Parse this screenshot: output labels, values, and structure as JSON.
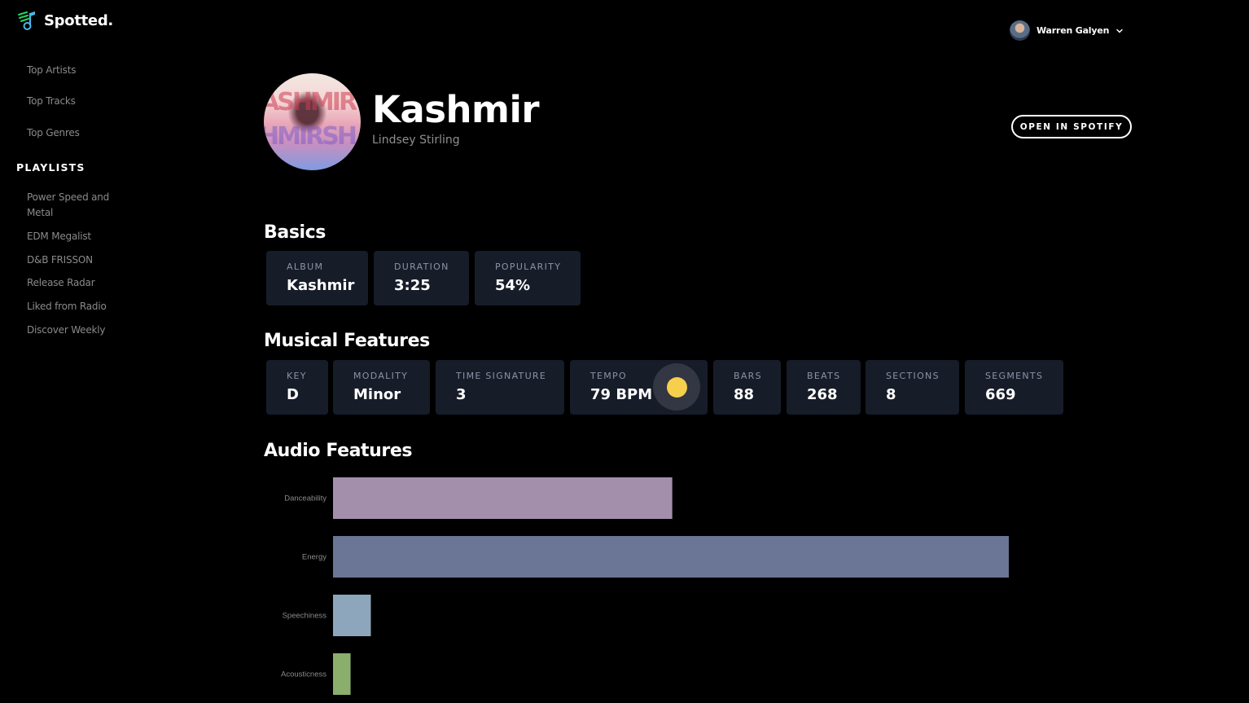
{
  "app": {
    "name": "Spotted."
  },
  "sidebar": {
    "nav": [
      "Top Artists",
      "Top Tracks",
      "Top Genres"
    ],
    "playlists_heading": "PLAYLISTS",
    "playlists": [
      "Power Speed and Metal",
      "EDM Megalist",
      "D&B FRISSON",
      "Release Radar",
      "Liked from Radio",
      "Discover Weekly"
    ]
  },
  "user": {
    "name": "Warren Galyen"
  },
  "track": {
    "title": "Kashmir",
    "artist": "Lindsey Stirling",
    "open_button": "OPEN IN SPOTIFY"
  },
  "basics": {
    "title": "Basics",
    "cards": [
      {
        "label": "ALBUM",
        "value": "Kashmir"
      },
      {
        "label": "DURATION",
        "value": "3:25"
      },
      {
        "label": "POPULARITY",
        "value": "54%"
      }
    ]
  },
  "musical": {
    "title": "Musical Features",
    "cards": [
      {
        "label": "KEY",
        "value": "D"
      },
      {
        "label": "MODALITY",
        "value": "Minor"
      },
      {
        "label": "TIME SIGNATURE",
        "value": "3"
      },
      {
        "label": "TEMPO",
        "value": "79 BPM"
      },
      {
        "label": "BARS",
        "value": "88"
      },
      {
        "label": "BEATS",
        "value": "268"
      },
      {
        "label": "SECTIONS",
        "value": "8"
      },
      {
        "label": "SEGMENTS",
        "value": "669"
      }
    ]
  },
  "audio": {
    "title": "Audio Features"
  },
  "colors": {
    "card_bg": "#171c29",
    "tempo_indicator": "#f6cf4c"
  },
  "chart_data": {
    "type": "bar",
    "orientation": "horizontal",
    "categories": [
      "Danceability",
      "Energy",
      "Speechiness",
      "Acousticness"
    ],
    "values": [
      0.502,
      1.0,
      0.056,
      0.026
    ],
    "colors": [
      "#a38eab",
      "#6b7595",
      "#8ea6bb",
      "#8aae6c"
    ],
    "xlim": [
      0,
      1
    ],
    "grid": false,
    "legend": "none"
  }
}
